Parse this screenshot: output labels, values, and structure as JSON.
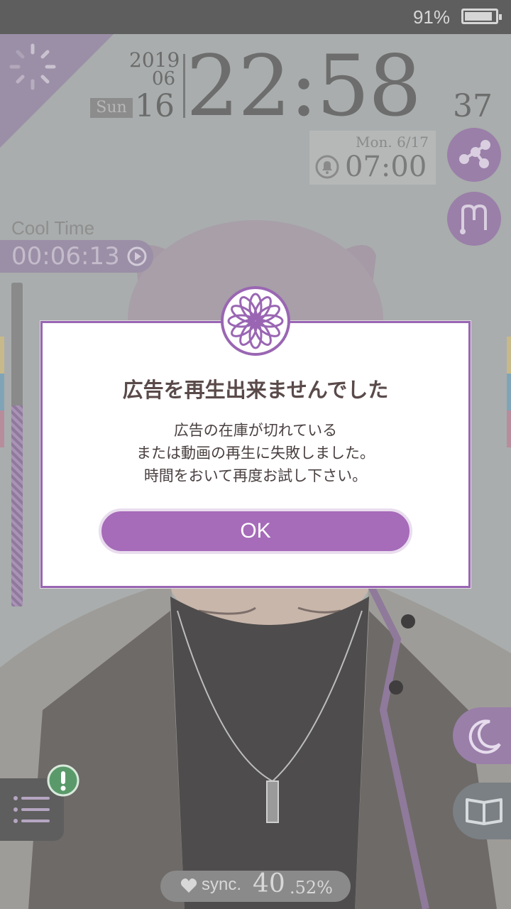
{
  "status_bar": {
    "battery_percent_text": "91%",
    "battery_level": 0.91
  },
  "clock": {
    "year": "2019",
    "month": "06",
    "day_of_week": "Sun",
    "day": "16",
    "time": "22:58",
    "seconds": "37"
  },
  "alarm": {
    "date": "Mon.  6/17",
    "time": "07:00"
  },
  "cool_time": {
    "label": "Cool Time",
    "value": "00:06:13"
  },
  "gauge": {
    "level": 0.62
  },
  "sync": {
    "label": "sync.",
    "value_int": "40",
    "value_frac": ".52%"
  },
  "dialog": {
    "title": "広告を再生出来ませんでした",
    "message_lines": [
      "広告の在庫が切れている",
      "または動画の再生に失敗しました。",
      "時間をおいて再度お試し下さい。"
    ],
    "ok_label": "OK"
  },
  "icons": {
    "spinner": "loading-spinner-icon",
    "bell": "alarm-bell-icon",
    "share": "share-icon",
    "route": "route-icon",
    "play": "play-icon",
    "alert": "exclamation-icon",
    "menu": "list-menu-icon",
    "moon": "moon-icon",
    "book": "book-icon",
    "heart": "heart-icon",
    "emblem": "flower-emblem-icon"
  },
  "colors": {
    "accent": "#a66bb9",
    "accent_dark": "#9a7fa9",
    "status_bar": "#5e5e5e",
    "side_tab_yellow": "#c8b98a",
    "side_tab_blue": "#7fa4b8",
    "side_tab_pink": "#b78d9c"
  }
}
